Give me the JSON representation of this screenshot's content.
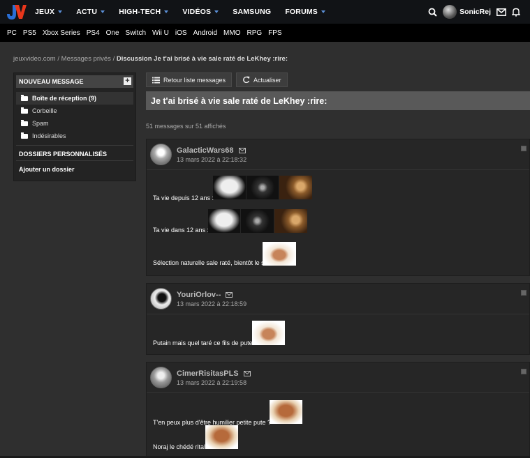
{
  "header": {
    "nav": [
      "JEUX",
      "ACTU",
      "HIGH-TECH",
      "VIDÉOS",
      "SAMSUNG",
      "FORUMS"
    ],
    "username": "SonicRej"
  },
  "subnav": [
    "PC",
    "PS5",
    "Xbox Series",
    "PS4",
    "One",
    "Switch",
    "Wii U",
    "iOS",
    "Android",
    "MMO",
    "RPG",
    "FPS"
  ],
  "breadcrumb": {
    "site": "jeuxvideo.com",
    "sep": " / ",
    "section": "Messages privés",
    "current": "Discussion Je t'ai brisé à vie sale raté de LeKhey :rire:"
  },
  "sidebar": {
    "new_message": "NOUVEAU MESSAGE",
    "folders": [
      "Boîte de réception (9)",
      "Corbeille",
      "Spam",
      "Indésirables"
    ],
    "personal_title": "DOSSIERS PERSONNALISÉS",
    "add_folder": "Ajouter un dossier"
  },
  "toolbar": {
    "back": "Retour liste messages",
    "refresh": "Actualiser"
  },
  "topic": {
    "title": "Je t'ai brisé à vie sale raté de LeKhey :rire:",
    "count": "51 messages sur 51 affichés"
  },
  "messages": [
    {
      "author": "GalacticWars68",
      "date": "13 mars 2022 à 22:18:32",
      "lines": [
        "Ta vie depuis 12 ans :",
        "Ta vie dans 12 ans :",
        "Sélection naturelle sale raté, bientôt le s"
      ]
    },
    {
      "author": "YouriOrlov--",
      "date": "13 mars 2022 à 22:18:59",
      "lines": [
        "Putain mais quel taré ce fils de pute"
      ]
    },
    {
      "author": "CimerRisitasPLS",
      "date": "13 mars 2022 à 22:19:58",
      "lines": [
        "T'en peux plus d'être humilier petite pute ?",
        "Noraj le chédé rital"
      ]
    }
  ],
  "colors": {
    "topbar": "#111316",
    "accent_blue": "#5b8fd6",
    "logo_red": "#e8361b",
    "logo_blue": "#2a6fd6"
  }
}
